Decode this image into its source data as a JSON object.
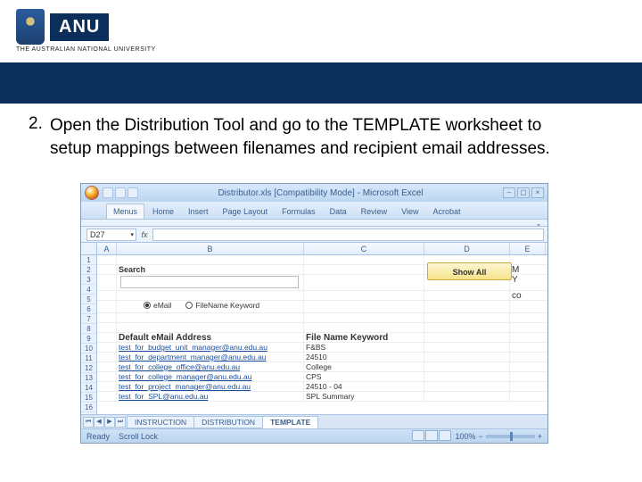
{
  "logo": {
    "text": "ANU",
    "subtitle": "THE AUSTRALIAN NATIONAL UNIVERSITY"
  },
  "instruction": {
    "number": "2.",
    "text": "Open the Distribution Tool and go to the TEMPLATE worksheet to setup mappings between filenames and recipient email addresses."
  },
  "excel": {
    "title": "Distributor.xls [Compatibility Mode] - Microsoft Excel",
    "tabs": [
      "Menus",
      "Home",
      "Insert",
      "Page Layout",
      "Formulas",
      "Data",
      "Review",
      "View",
      "Acrobat"
    ],
    "active_tab": "Menus",
    "namebox": "D27",
    "columns": [
      "A",
      "B",
      "C",
      "D",
      "E"
    ],
    "rownums": [
      "1",
      "2",
      "3",
      "4",
      "5",
      "6",
      "7",
      "8",
      "9",
      "10",
      "11",
      "12",
      "13",
      "14",
      "15",
      "16"
    ],
    "search_label": "Search",
    "showall": "Show All",
    "radio1": "eMail",
    "radio2": "FileName Keyword",
    "hdr_email": "Default eMail Address",
    "hdr_keyword": "File Name Keyword",
    "colE_vals": [
      "M",
      "Y",
      "co"
    ],
    "rows": [
      {
        "email": "test_for_budget_unit_manager@anu.edu.au",
        "kw": "F&BS"
      },
      {
        "email": "test_for_department_manager@anu.edu.au",
        "kw": "24510"
      },
      {
        "email": "test_for_college_office@anu.edu.au",
        "kw": "College"
      },
      {
        "email": "test_for_college_manager@anu.edu.au",
        "kw": "CPS"
      },
      {
        "email": "test_for_project_manager@anu.edu.au",
        "kw": "24510 - 04"
      },
      {
        "email": "test_for_SPL@anu.edu.au",
        "kw": "SPL Summary"
      }
    ],
    "sheets": [
      "INSTRUCTION",
      "DISTRIBUTION",
      "TEMPLATE"
    ],
    "active_sheet": "TEMPLATE",
    "status_ready": "Ready",
    "status_scroll": "Scroll Lock",
    "zoom": "100%"
  }
}
